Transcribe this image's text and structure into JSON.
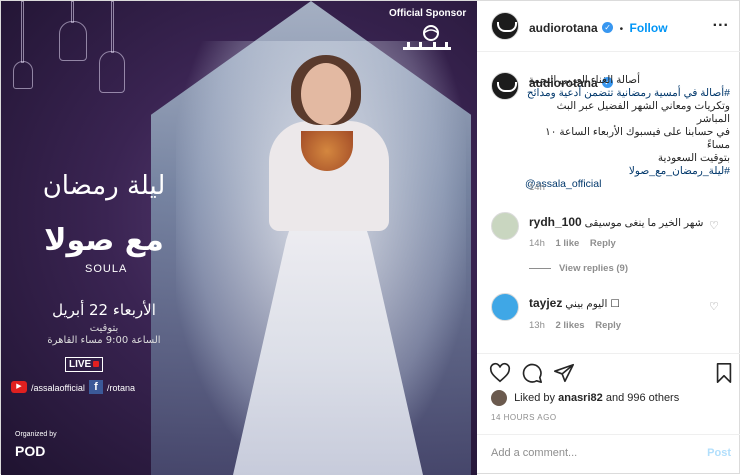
{
  "media": {
    "sponsor_label": "Official Sponsor",
    "title_ar": "ليلة رمضان",
    "with_ar": "مع صولا",
    "soula": "SOULA",
    "date_ar": "الأربعاء 22 أبريل",
    "time_ar_1": "بتوقيت",
    "time_ar_2": "الساعة 9:00 مساء القاهرة",
    "live": "LIVE",
    "youtube_label": "/assalaofficial",
    "facebook_label": "/rotana",
    "organized_by": "Organized by",
    "organizer": "POD"
  },
  "header": {
    "username": "audiorotana",
    "separator": "•",
    "follow": "Follow",
    "more": "..."
  },
  "caption": {
    "username": "audiorotana",
    "line1": "أصالة الغناء العربي النجمة",
    "line2": "#أصالة في أمسية رمضانية تتضمن أدعية ومدائح",
    "line3": "وتكريات ومعاني الشهر الفضيل عبر البث المباشر",
    "line4": "في حسابنا على فيسبوك  الأربعاء الساعة ١٠ مساءً",
    "line5": "بتوقيت السعودية",
    "hashtag": "#ليلة_رمضان_مع_صولا",
    "mention": "@assala_official",
    "time": "14h"
  },
  "comments": [
    {
      "username": "rydh_100",
      "text": "شهر الخير ما ينغى موسيقى",
      "time": "14h",
      "likes": "1 like",
      "reply": "Reply",
      "view_replies": "View replies (9)"
    },
    {
      "username": "tayjez",
      "text": "اليوم بيني ☐",
      "time": "13h",
      "likes": "2 likes",
      "reply": "Reply"
    }
  ],
  "actions": {
    "liked_by_prefix": "Liked by",
    "liked_by_user": "anasri82",
    "liked_by_suffix": "and 996 others",
    "time_ago": "14 HOURS AGO"
  },
  "add_comment": {
    "placeholder": "Add a comment...",
    "post": "Post"
  },
  "colors": {
    "accent": "#0095f6",
    "verified": "#3897f0",
    "muted": "#8e8e8e"
  }
}
